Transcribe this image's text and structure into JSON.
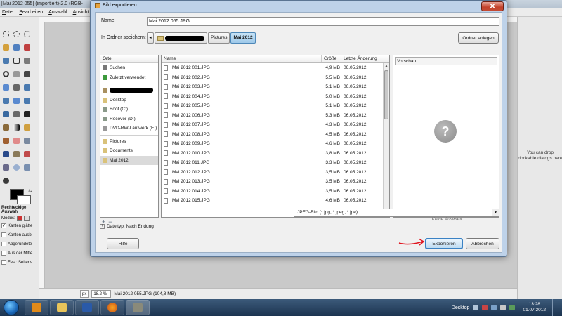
{
  "gimp": {
    "title": "[Mai 2012 055] (importiert)-2.0 (RGB-",
    "menu": [
      "Datei",
      "Bearbeiten",
      "Auswahl",
      "Ansicht"
    ],
    "tool_options": {
      "title": "Rechteckige Auswah",
      "mode_label": "Modus:",
      "checkboxes": [
        "Kanten glätte",
        "Kanten ausbl",
        "Abgerundete",
        "Aus der Mitte",
        "Fest: Seitenv"
      ]
    },
    "dock_hint": "You can drop dockable dialogs here",
    "status": {
      "unit": "px",
      "zoom": "18.2 %",
      "text": "Mai 2012 055.JPG (104,8 MB)"
    }
  },
  "dialog": {
    "title": "Bild exportieren",
    "name_label": "Name:",
    "name_value": "Mai 2012 055.JPG",
    "folder_label": "In Ordner speichern:",
    "breadcrumbs": [
      "Pictures",
      "Mai 2012"
    ],
    "create_folder": "Ordner anlegen",
    "places_header": "Orte",
    "places": [
      {
        "label": "Suchen",
        "icon": "search-icon",
        "color": "#777777"
      },
      {
        "label": "Zuletzt verwendet",
        "icon": "recent-icon",
        "color": "#3c9a3c"
      },
      {
        "label": "",
        "icon": "home-folder-icon",
        "color": "#a89060",
        "redacted": true
      },
      {
        "label": "Desktop",
        "icon": "desktop-folder-icon",
        "color": "#d9c27a"
      },
      {
        "label": "Boot (C:)",
        "icon": "drive-icon",
        "color": "#8a9a8a"
      },
      {
        "label": "Recover (D:)",
        "icon": "drive-icon",
        "color": "#8a9a8a"
      },
      {
        "label": "DVD-RW-Laufwerk (E:)",
        "icon": "optical-drive-icon",
        "color": "#999999"
      },
      {
        "label": "Pictures",
        "icon": "folder-icon",
        "color": "#d9c27a"
      },
      {
        "label": "Documents",
        "icon": "folder-icon",
        "color": "#d9c27a"
      },
      {
        "label": "Mai 2012",
        "icon": "folder-icon",
        "color": "#d9c27a",
        "selected": true
      }
    ],
    "columns": {
      "name": "Name",
      "size": "Größe",
      "date": "Letzte Änderung"
    },
    "files": [
      {
        "name": "Mai 2012 001.JPG",
        "size": "4,9 MB",
        "date": "06.05.2012"
      },
      {
        "name": "Mai 2012 002.JPG",
        "size": "5,5 MB",
        "date": "06.05.2012"
      },
      {
        "name": "Mai 2012 003.JPG",
        "size": "5,1 MB",
        "date": "06.05.2012"
      },
      {
        "name": "Mai 2012 004.JPG",
        "size": "5,0 MB",
        "date": "06.05.2012"
      },
      {
        "name": "Mai 2012 005.JPG",
        "size": "5,1 MB",
        "date": "06.05.2012"
      },
      {
        "name": "Mai 2012 006.JPG",
        "size": "5,3 MB",
        "date": "06.05.2012"
      },
      {
        "name": "Mai 2012 007.JPG",
        "size": "4,3 MB",
        "date": "06.05.2012"
      },
      {
        "name": "Mai 2012 008.JPG",
        "size": "4,5 MB",
        "date": "06.05.2012"
      },
      {
        "name": "Mai 2012 009.JPG",
        "size": "4,6 MB",
        "date": "06.05.2012"
      },
      {
        "name": "Mai 2012 010.JPG",
        "size": "3,8 MB",
        "date": "06.05.2012"
      },
      {
        "name": "Mai 2012 011.JPG",
        "size": "3,3 MB",
        "date": "06.05.2012"
      },
      {
        "name": "Mai 2012 012.JPG",
        "size": "3,5 MB",
        "date": "06.05.2012"
      },
      {
        "name": "Mai 2012 013.JPG",
        "size": "3,5 MB",
        "date": "06.05.2012"
      },
      {
        "name": "Mai 2012 014.JPG",
        "size": "3,5 MB",
        "date": "06.05.2012"
      },
      {
        "name": "Mai 2012 015.JPG",
        "size": "4,6 MB",
        "date": "06.05.2012"
      }
    ],
    "preview_header": "Vorschau",
    "preview_text": "Keine Auswahl",
    "filter": "JPEG-Bild (*.jpg, *.jpeg, *.jpe)",
    "filetype_label": "Dateityp: Nach Endung",
    "help": "Hilfe",
    "export": "Exportieren",
    "cancel": "Abbrechen"
  },
  "taskbar": {
    "apps": [
      "media-player-icon",
      "explorer-icon",
      "word-icon",
      "firefox-icon",
      "gimp-icon"
    ],
    "desktop_label": "Desktop",
    "time": "13:28",
    "date": "01.07.2012"
  },
  "colors": {
    "accent": "#3b82c4",
    "annotation_arrow": "#e0141e",
    "dialog_frame": "#bed2e9"
  }
}
